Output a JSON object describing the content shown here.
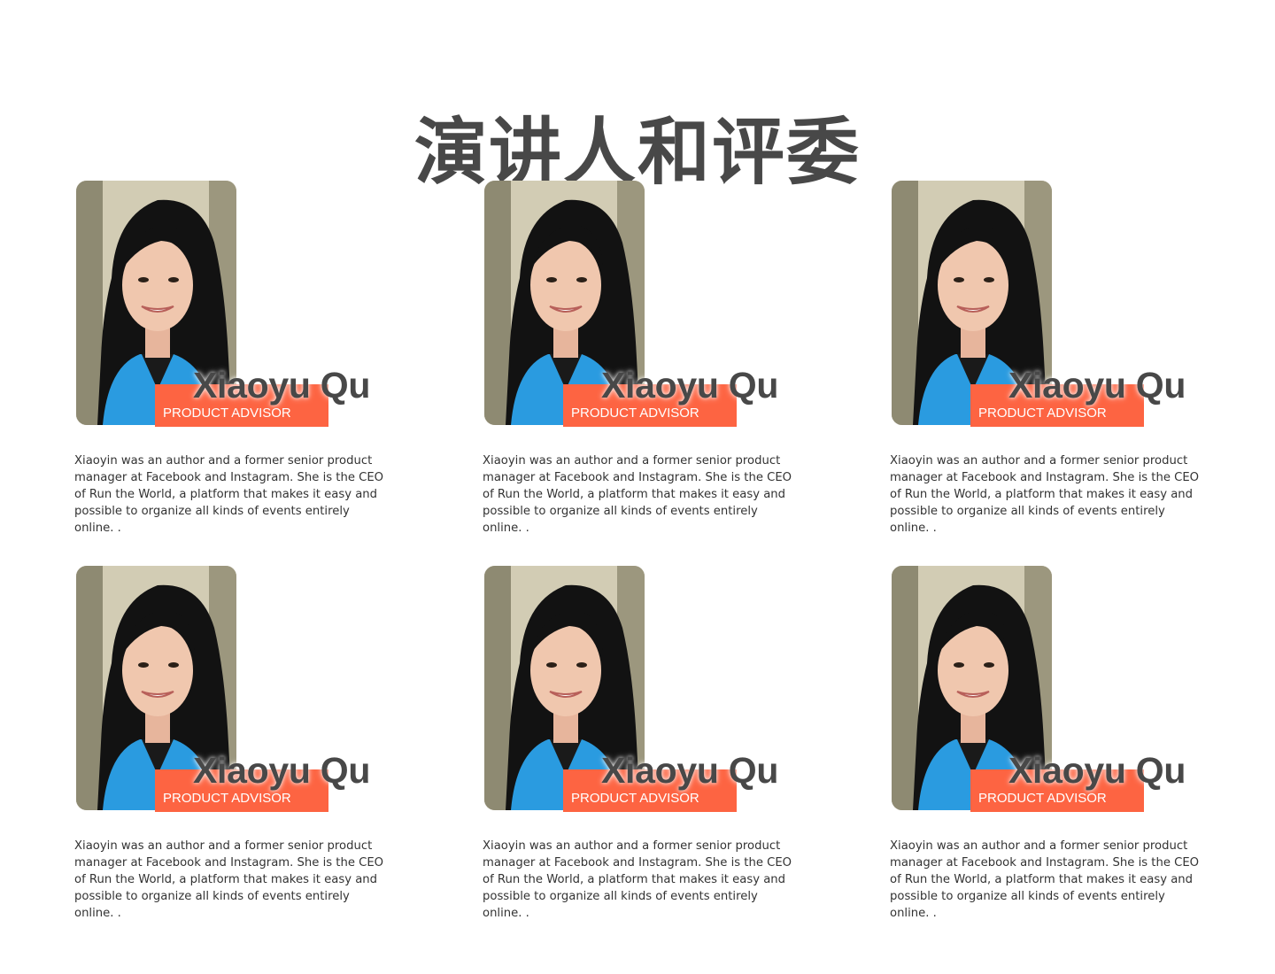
{
  "page": {
    "title": "演讲人和评委"
  },
  "speakers": [
    {
      "name": "Xiaoyu Qu",
      "role": "PRODUCT ADVISOR",
      "bio": "Xiaoyin was an author and a former senior product manager at Facebook and Instagram. She is the CEO of Run the World, a platform that makes it easy and possible to organize all kinds of events entirely online. ."
    },
    {
      "name": "Xiaoyu Qu",
      "role": "PRODUCT ADVISOR",
      "bio": "Xiaoyin was an author and a former senior product manager at Facebook and Instagram. She is the CEO of Run the World, a platform that makes it easy and possible to organize all kinds of events entirely online. ."
    },
    {
      "name": "Xiaoyu Qu",
      "role": "PRODUCT ADVISOR",
      "bio": "Xiaoyin was an author and a former senior product manager at Facebook and Instagram. She is the CEO of Run the World, a platform that makes it easy and possible to organize all kinds of events entirely online. ."
    },
    {
      "name": "Xiaoyu Qu",
      "role": "PRODUCT ADVISOR",
      "bio": "Xiaoyin was an author and a former senior product manager at Facebook and Instagram. She is the CEO of Run the World, a platform that makes it easy and possible to organize all kinds of events entirely online. ."
    },
    {
      "name": "Xiaoyu Qu",
      "role": "PRODUCT ADVISOR",
      "bio": "Xiaoyin was an author and a former senior product manager at Facebook and Instagram. She is the CEO of Run the World, a platform that makes it easy and possible to organize all kinds of events entirely online. ."
    },
    {
      "name": "Xiaoyu Qu",
      "role": "PRODUCT ADVISOR",
      "bio": "Xiaoyin was an author and a former senior product manager at Facebook and Instagram. She is the CEO of Run the World, a platform that makes it easy and possible to organize all kinds of events entirely online. ."
    }
  ],
  "colors": {
    "title": "#484848",
    "accent": "#fd6442",
    "body_text": "#333333",
    "background": "#ffffff"
  }
}
